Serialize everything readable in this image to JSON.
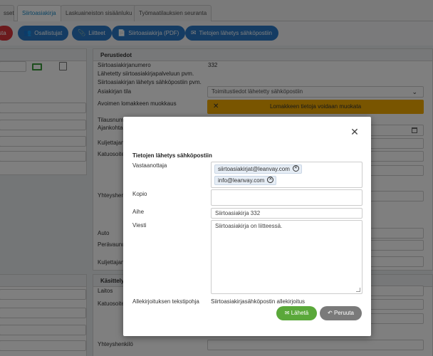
{
  "tabs": [
    {
      "label": "sset",
      "active": false
    },
    {
      "label": "Siirtoasiakirja",
      "active": true
    },
    {
      "label": "Laskuaineiston sisäänluku",
      "active": false
    },
    {
      "label": "Työmaatilauksien seuranta",
      "active": false
    }
  ],
  "toolbar": {
    "partial_label": "sta",
    "buttons": [
      {
        "label": "Osallistujat",
        "icon": "users-icon"
      },
      {
        "label": "Liitteet",
        "icon": "paperclip-icon"
      },
      {
        "label": "Siirtoasiakirja (PDF)",
        "icon": "file-icon"
      },
      {
        "label": "Tietojen lähetys sähköpostiin",
        "icon": "envelope-icon"
      }
    ]
  },
  "basic_info": {
    "header": "Perustiedot",
    "doc_number_label": "Siirtoasiakirjanumero",
    "doc_number_value": "332",
    "service_sent_label": "Lähetetty siirtoasiakirjapalveluun pvm.",
    "email_sent_label": "Siirtoasiakirjan lähetys sähköpostiin pvm.",
    "status_label": "Asiakirjan tila",
    "status_value": "Toimitustiedot lähetetty sähköpostiin",
    "open_form_label": "Avoimen lomakkeen muokkaus",
    "open_form_value": "Lomakkeen tietoja voidaan muokata",
    "partial_labels": [
      "Tilausnum",
      "Ajankohta",
      "Kuljettajan",
      "Katuosoite",
      "Yhteyshenkil",
      "Auto",
      "Perävaunu",
      "Kuljettajan"
    ]
  },
  "handling": {
    "header": "Käsittely",
    "labels": [
      "Laitos",
      "Katuosoite",
      "Yhteyshenkilö"
    ]
  },
  "modal": {
    "title": "Tietojen lähetys sähköpostiin",
    "recipients_label": "Vastaanottaja",
    "recipients": [
      "siirtoasiakirjat@leanvay.com",
      "info@leanvay.com"
    ],
    "cc_label": "Kopio",
    "cc_value": "",
    "subject_label": "Aihe",
    "subject_value": "Siirtoasiakirja 332",
    "message_label": "Viesti",
    "message_value": "Siirtoasiakirja on liitteessä.",
    "signature_label": "Allekirjoituksen tekstipohja",
    "signature_value": "Siirtoasiakirjasähköpostin allekirjoitus",
    "send_label": "Lähetä",
    "cancel_label": "Peruuta"
  },
  "colors": {
    "primary": "#2a78c6",
    "danger": "#d8343b",
    "warning": "#f2ab00",
    "success": "#5aa83a",
    "neutral": "#7a7a7a"
  }
}
